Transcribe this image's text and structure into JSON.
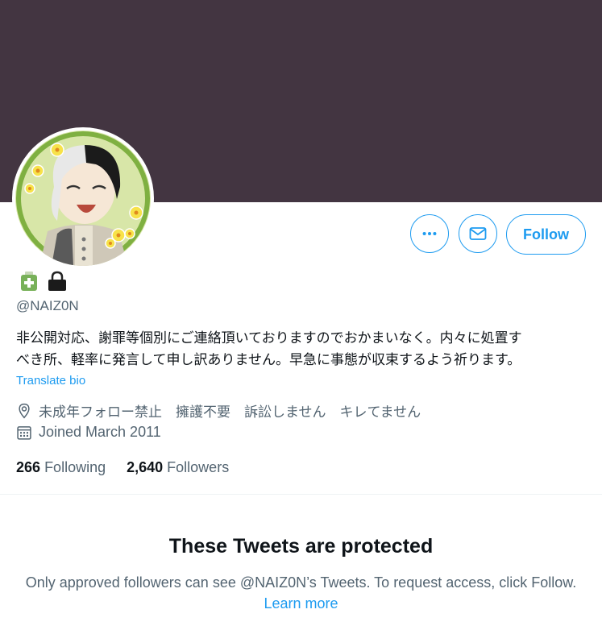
{
  "colors": {
    "banner": "#433541",
    "accent": "#1d9bf0",
    "secondary_text": "#536471"
  },
  "actions": {
    "more_icon": "more-horizontal-icon",
    "message_icon": "envelope-icon",
    "follow_label": "Follow"
  },
  "profile": {
    "handle": "@NAIZ0N",
    "badges": [
      "medical-kit-icon",
      "lock-icon"
    ],
    "bio_line1": "非公開対応、謝罪等個別にご連絡頂いておりますのでおかまいなく。内々に処置す",
    "bio_line2": "べき所、軽率に発言して申し訳ありません。早急に事態が収束するよう祈ります。",
    "translate_label": "Translate bio",
    "location": "未成年フォロー禁止　擁護不要　訴訟しません　キレてません",
    "joined": "Joined March 2011"
  },
  "stats": {
    "following_count": "266",
    "following_label": "Following",
    "followers_count": "2,640",
    "followers_label": "Followers"
  },
  "protected": {
    "title": "These Tweets are protected",
    "text": "Only approved followers can see @NAIZ0N’s Tweets. To request access, click Follow.",
    "learn_more": "Learn more"
  }
}
